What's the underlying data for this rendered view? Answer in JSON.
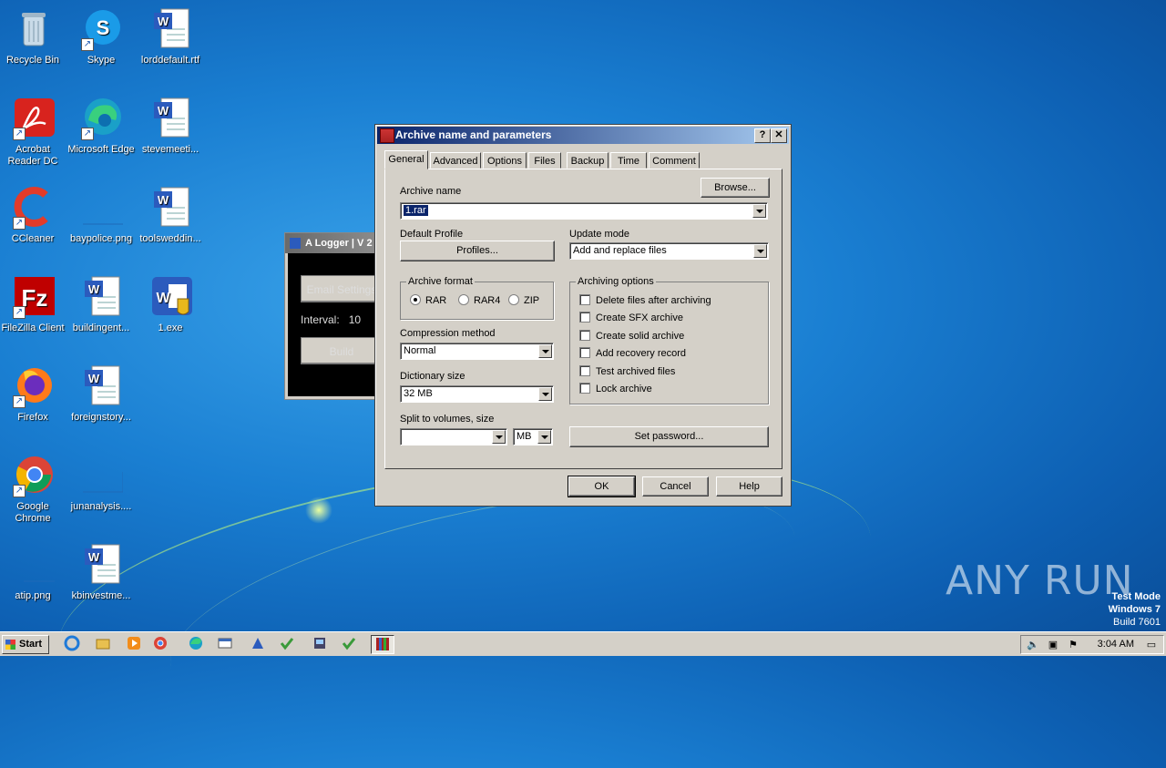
{
  "desktop": {
    "icons": [
      {
        "label": "Recycle Bin",
        "icon": "recycle-bin-icon"
      },
      {
        "label": "Skype",
        "icon": "skype-icon"
      },
      {
        "label": "lorddefault.rtf",
        "icon": "word-document-icon"
      },
      {
        "label": "Acrobat Reader DC",
        "icon": "acrobat-icon"
      },
      {
        "label": "Microsoft Edge",
        "icon": "edge-icon"
      },
      {
        "label": "stevemeeti...",
        "icon": "word-document-icon"
      },
      {
        "label": "CCleaner",
        "icon": "ccleaner-icon"
      },
      {
        "label": "baypolice.png",
        "icon": "image-file-icon"
      },
      {
        "label": "toolsweddin...",
        "icon": "word-document-icon"
      },
      {
        "label": "FileZilla Client",
        "icon": "filezilla-icon"
      },
      {
        "label": "buildingent...",
        "icon": "word-document-icon"
      },
      {
        "label": "1.exe",
        "icon": "word-exe-icon"
      },
      {
        "label": "Firefox",
        "icon": "firefox-icon"
      },
      {
        "label": "foreignstory...",
        "icon": "word-document-icon"
      },
      {
        "label": "Google Chrome",
        "icon": "chrome-icon"
      },
      {
        "label": "junanalysis....",
        "icon": "image-file-icon"
      },
      {
        "label": "atip.png",
        "icon": "image-file-icon"
      },
      {
        "label": "kbinvestme...",
        "icon": "word-document-icon"
      }
    ],
    "watermark": "ANY RUN",
    "test_mode": {
      "line1": "Test Mode",
      "line2": "Windows 7",
      "line3": "Build 7601"
    }
  },
  "logger": {
    "title": "A Logger | V 2",
    "email_button": "Email Settings",
    "interval_label": "Interval:",
    "interval_value": "10",
    "build_button": "Build"
  },
  "dialog": {
    "title": "Archive name and parameters",
    "help_btn": "?",
    "close_btn": "✕",
    "tabs": [
      "General",
      "Advanced",
      "Options",
      "Files",
      "Backup",
      "Time",
      "Comment"
    ],
    "browse_label": "Browse...",
    "archive_name_label": "Archive name",
    "archive_name_value": "1.rar",
    "default_profile_label": "Default Profile",
    "profiles_label": "Profiles...",
    "update_mode_label": "Update mode",
    "update_mode_value": "Add and replace files",
    "archive_format_label": "Archive format",
    "formats": {
      "rar": "RAR",
      "rar4": "RAR4",
      "zip": "ZIP",
      "selected": "RAR"
    },
    "compression_label": "Compression method",
    "compression_value": "Normal",
    "dictionary_label": "Dictionary size",
    "dictionary_value": "32 MB",
    "split_label": "Split to volumes, size",
    "split_value": "",
    "split_unit": "MB",
    "archiving_options_label": "Archiving options",
    "options": [
      "Delete files after archiving",
      "Create SFX archive",
      "Create solid archive",
      "Add recovery record",
      "Test archived files",
      "Lock archive"
    ],
    "set_password_label": "Set password...",
    "ok_label": "OK",
    "cancel_label": "Cancel",
    "help_label": "Help"
  },
  "taskbar": {
    "start_label": "Start",
    "clock": "3:04 AM"
  }
}
